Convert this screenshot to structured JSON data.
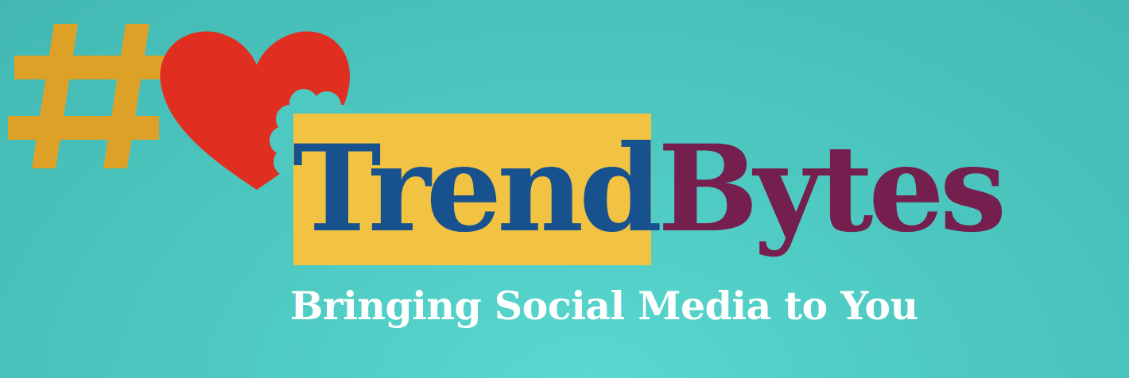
{
  "brand": {
    "word_one": "Trend",
    "word_two": "Bytes",
    "tagline": "Bringing Social Media to You"
  },
  "icons": [
    "hashtag-icon",
    "bitten-heart-icon"
  ],
  "colors": {
    "background": "#4dc9c1",
    "hashtag": "#dea127",
    "heart": "#e02f20",
    "highlight": "#f2c342",
    "trend_text": "#17528f",
    "bytes_text": "#741f4e",
    "tagline_text": "#ffffff"
  }
}
